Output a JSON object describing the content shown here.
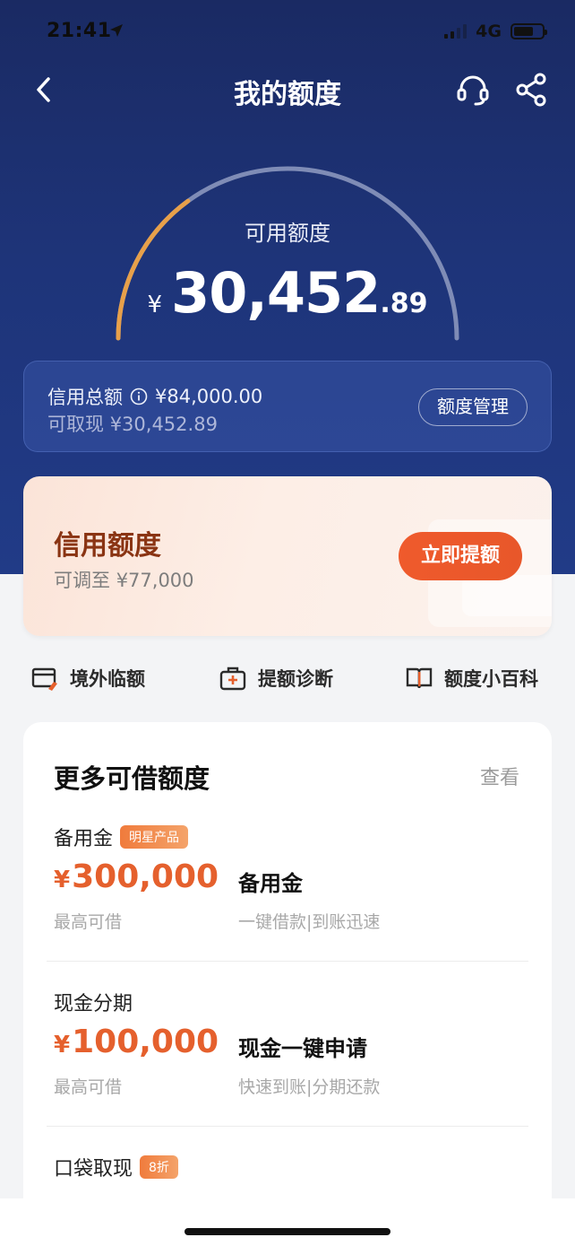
{
  "status_bar": {
    "time": "21:41",
    "network": "4G"
  },
  "nav": {
    "title": "我的额度"
  },
  "gauge": {
    "label": "可用额度",
    "currency": "¥",
    "amount_int": "30,452",
    "amount_dec": ".89",
    "used_fraction": 0.3,
    "colors": {
      "used": "#e7a04a",
      "rest": "#7f8cb6"
    }
  },
  "total": {
    "label": "信用总额",
    "value": "¥84,000.00",
    "cash_label": "可取现",
    "cash_value": "¥30,452.89",
    "manage_label": "额度管理"
  },
  "credit": {
    "title": "信用额度",
    "sub_label": "可调至",
    "sub_value": "¥77,000",
    "button": "立即提额"
  },
  "shortcuts": [
    {
      "label": "境外临额",
      "icon": "card-plane-icon"
    },
    {
      "label": "提额诊断",
      "icon": "medkit-icon"
    },
    {
      "label": "额度小百科",
      "icon": "book-icon"
    }
  ],
  "more": {
    "title": "更多可借额度",
    "view": "查看",
    "items": [
      {
        "name": "备用金",
        "tag": "明星产品",
        "amount": "300,000",
        "max_label": "最高可借",
        "headline": "备用金",
        "desc": "一键借款|到账迅速"
      },
      {
        "name": "现金分期",
        "tag": "",
        "amount": "100,000",
        "max_label": "最高可借",
        "headline": "现金一键申请",
        "desc": "快速到账|分期还款"
      },
      {
        "name": "口袋取现",
        "tag": "8折"
      }
    ]
  },
  "colors": {
    "accent": "#e5602d",
    "hero": "#1e3479"
  }
}
